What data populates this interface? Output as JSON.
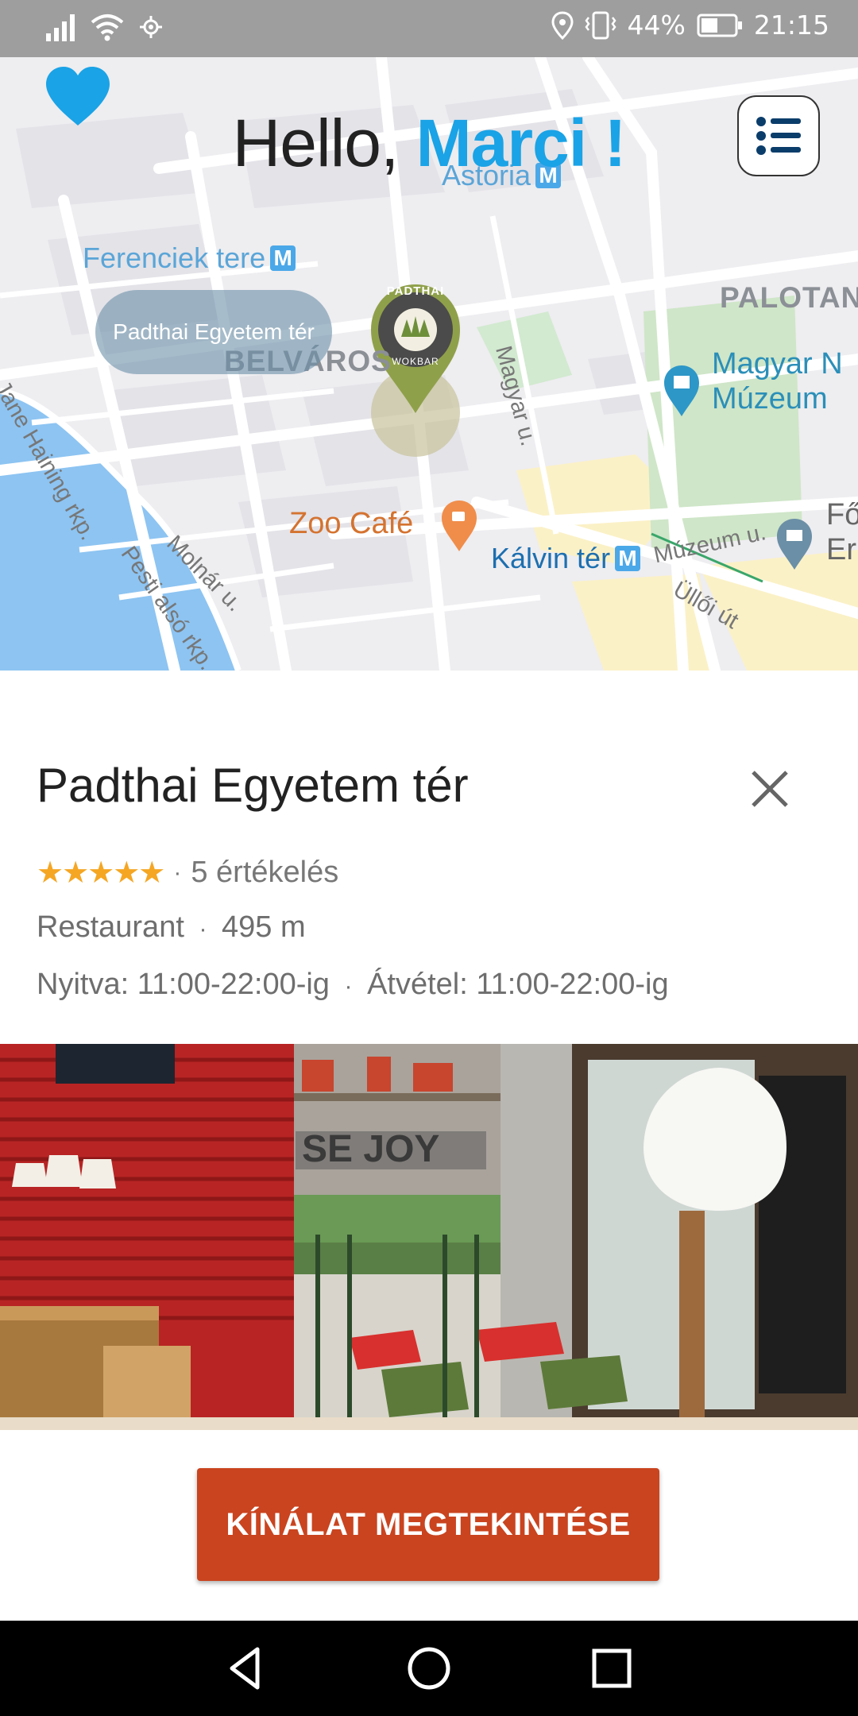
{
  "status_bar": {
    "battery_percent": "44%",
    "time": "21:15",
    "icons": [
      "signal-icon",
      "wifi-icon",
      "nfc-icon",
      "location-icon",
      "vibrate-icon",
      "battery-icon"
    ]
  },
  "header": {
    "greeting_prefix": "Hello,",
    "greeting_name": "Marci !",
    "favorites_icon": "heart-icon",
    "menu_icon": "list-menu-icon"
  },
  "map": {
    "labels": {
      "astoria": "Astoria",
      "ferenciek": "Ferenciek tere",
      "palotanegyed": "PALOTAN",
      "belvaros": "BELVÁROS",
      "magyar_u": "Magyar u.",
      "museum_line1": "Magyar N",
      "museum_line2": "Múzeum",
      "jane_haining": "Jane Haining rkp.",
      "molnar_u": "Molnár u.",
      "zoo_cafe": "Zoo Café",
      "muzeum_u": "Múzeum u.",
      "library_line1": "Fő",
      "library_line2": "Er",
      "kalvin_ter": "Kálvin tér",
      "ulloi_ut": "Üllői út",
      "pesti_also": "Pesti alsó rkp.",
      "metro_symbol": "M"
    },
    "pin_tooltip": "Padthai Egyetem tér",
    "pin_logo_top": "PADTHAI",
    "pin_logo_bottom": "WOKBAR"
  },
  "place": {
    "name": "Padthai Egyetem tér",
    "stars": "★★★★★",
    "rating_count": "5 értékelés",
    "separator": "·",
    "category": "Restaurant",
    "distance": "495 m",
    "opening": "Nyitva: 11:00-22:00-ig",
    "pickup": "Átvétel: 11:00-22:00-ig",
    "photo_sign": "SE JOY"
  },
  "cta": {
    "label": "KÍNÁLAT MEGTEKINTÉSE"
  },
  "nav": {
    "icons": [
      "back-icon",
      "home-icon",
      "recents-icon"
    ]
  },
  "colors": {
    "accent_blue": "#1aa3e6",
    "cta_red": "#c9441f",
    "star_orange": "#f5a623",
    "pin_green": "#8fa04a"
  }
}
